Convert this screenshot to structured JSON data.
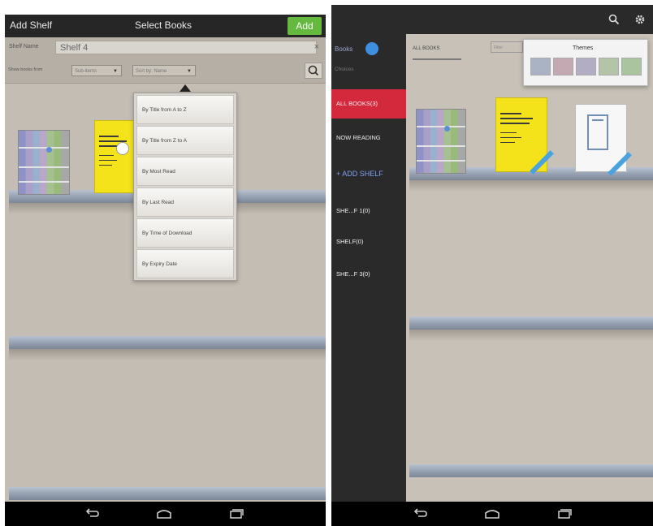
{
  "left": {
    "header": {
      "left_title": "Add Shelf",
      "center_title": "Select Books",
      "add_label": "Add"
    },
    "shelf_name": {
      "label": "Shelf Name",
      "value": "Shelf 4",
      "clear": "×"
    },
    "sort": {
      "label": "Show books from",
      "dropdown1": "Sub-items",
      "dropdown2": "Sort by: Name"
    },
    "sort_menu": [
      "By Title from A to Z",
      "By Title from Z to A",
      "By Most Read",
      "By Last Read",
      "By Time of Download",
      "By Expiry Date"
    ]
  },
  "right": {
    "brand": "Books",
    "brand_sub": "Choices",
    "sidebar": [
      {
        "label": "ALL BOOKS(3)",
        "active": true
      },
      {
        "label": "NOW READING",
        "active": false
      },
      {
        "label": "+ ADD SHELF",
        "active": false
      },
      {
        "label": "SHE...F 1(0)",
        "active": false
      },
      {
        "label": "SHELF(0)",
        "active": false
      },
      {
        "label": "SHE...F 3(0)",
        "active": false
      }
    ],
    "tabs": {
      "all_books": "ALL BOOKS",
      "filter": "Filter"
    },
    "themes": {
      "title": "Themes",
      "swatches": [
        "#aab3c4",
        "#c4a9b3",
        "#b3adc4",
        "#b3c4a8",
        "#a9c49e"
      ]
    }
  },
  "colors": {
    "accent_green": "#66b93f",
    "accent_red": "#d4283c",
    "brand_blue": "#3f8fe0"
  }
}
